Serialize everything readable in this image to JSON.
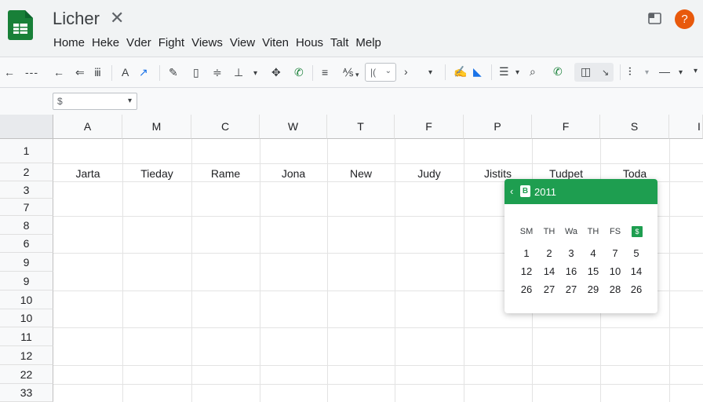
{
  "header": {
    "doc_title": "Licher",
    "title_close": "✕",
    "menu": [
      "Home",
      "Heke",
      "Vder",
      "Fight",
      "Views",
      "View",
      "Viten",
      "Hous",
      "Talt",
      "Melp"
    ],
    "avatar_glyph": "?",
    "icons": [
      "sheets-logo-icon",
      "comment-icon",
      "account-avatar"
    ]
  },
  "toolbar": {
    "font_size_value": "|(",
    "items": [
      "undo-icon",
      "minus-icon",
      "redo-icon",
      "paint-format-icon",
      "zoom-icon",
      "text-color-icon",
      "chart-icon",
      "pencil-icon",
      "clipboard-icon",
      "align-icon",
      "indent-icon",
      "move-icon",
      "phone-icon",
      "list-icon",
      "font-size-select",
      "chevron-right-icon",
      "chevron-down-icon",
      "highlight-icon",
      "fill-icon",
      "list-bullets-icon",
      "search-icon",
      "phone-icon",
      "split-view-icon",
      "pin-icon",
      "line-icon"
    ]
  },
  "formula_bar": {
    "name_box_value": "$"
  },
  "grid": {
    "columns": [
      "A",
      "M",
      "C",
      "W",
      "T",
      "F",
      "P",
      "F",
      "S",
      "I"
    ],
    "rows": [
      "1",
      "2",
      "3",
      "7",
      "8",
      "6",
      "9",
      "9",
      "10",
      "10",
      "11",
      "12",
      "22",
      "33"
    ],
    "row2_values": [
      "Jarta",
      "Tieday",
      "Rame",
      "Jona",
      "New",
      "Judy",
      "Jistits",
      "Tudpet",
      "Toda"
    ]
  },
  "date_picker": {
    "title": "2011",
    "prev_arrow": "‹",
    "icon_glyph": "B",
    "weekdays": [
      "SM",
      "TH",
      "Wa",
      "TH",
      "FS"
    ],
    "selected_weekday": "$",
    "weeks": [
      [
        "1",
        "2",
        "3",
        "4",
        "7",
        "5"
      ],
      [
        "12",
        "14",
        "16",
        "15",
        "10",
        "14"
      ],
      [
        "26",
        "27",
        "27",
        "29",
        "28",
        "26"
      ]
    ]
  },
  "colors": {
    "accent_green": "#1e9e50",
    "avatar_orange": "#e8590c",
    "toolbar_blue": "#1a73e8"
  }
}
